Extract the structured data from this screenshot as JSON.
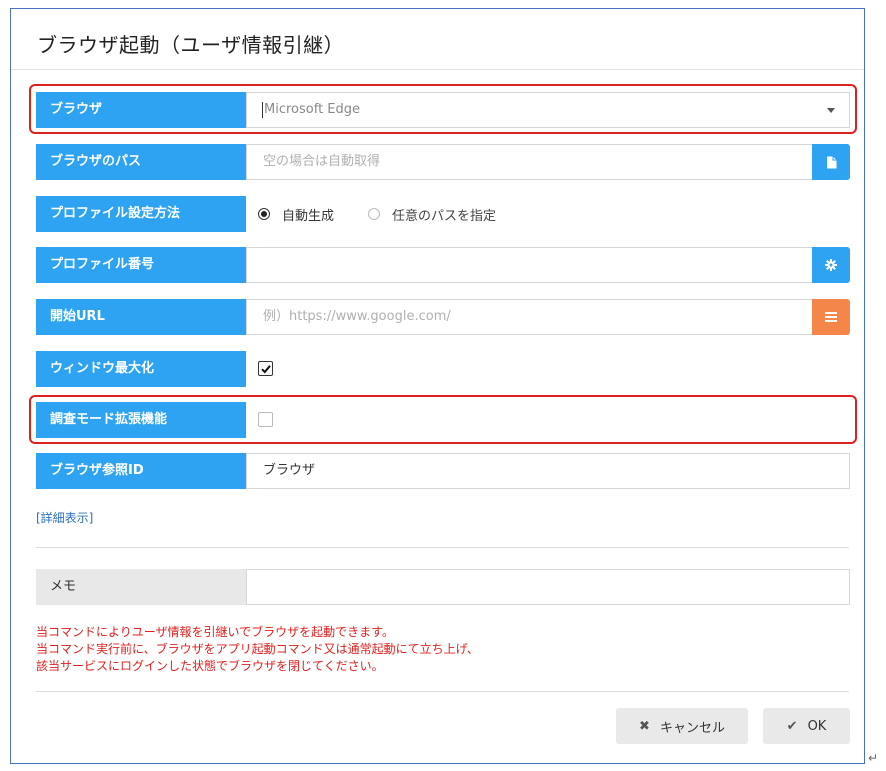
{
  "dialog": {
    "title": "ブラウザ起動（ユーザ情報引継）"
  },
  "fields": {
    "browser": {
      "label": "ブラウザ",
      "value": "Microsoft Edge"
    },
    "browser_path": {
      "label": "ブラウザのパス",
      "placeholder": "空の場合は自動取得",
      "button_icon": "file-icon"
    },
    "profile_method": {
      "label": "プロファイル設定方法",
      "options": [
        {
          "label": "自動生成",
          "selected": true
        },
        {
          "label": "任意のパスを指定",
          "selected": false
        }
      ]
    },
    "profile_number": {
      "label": "プロファイル番号",
      "value": "",
      "button_icon": "gear-icon"
    },
    "start_url": {
      "label": "開始URL",
      "placeholder": "例）https://www.google.com/",
      "button_icon": "list-icon"
    },
    "maximize_window": {
      "label": "ウィンドウ最大化",
      "checked": true
    },
    "investigation_mode": {
      "label": "調査モード拡張機能",
      "checked": false
    },
    "browser_ref_id": {
      "label": "ブラウザ参照ID",
      "value": "ブラウザ"
    }
  },
  "details_link": "[詳細表示]",
  "memo": {
    "label": "メモ",
    "value": ""
  },
  "notes": [
    "当コマンドによりユーザ情報を引継いでブラウザを起動できます。",
    "当コマンド実行前に、ブラウザをアプリ起動コマンド又は通常起動にて立ち上げ、",
    "該当サービスにログインした状態でブラウザを閉じてください。"
  ],
  "buttons": {
    "cancel": {
      "label": "キャンセル",
      "icon": "close-icon"
    },
    "ok": {
      "label": "OK",
      "icon": "check-icon"
    }
  },
  "colors": {
    "label_blue": "#2ea3f2",
    "orange_button": "#f5864a",
    "highlight_red": "#e02020",
    "dialog_border": "#4a72c4"
  },
  "return_mark": "↵"
}
